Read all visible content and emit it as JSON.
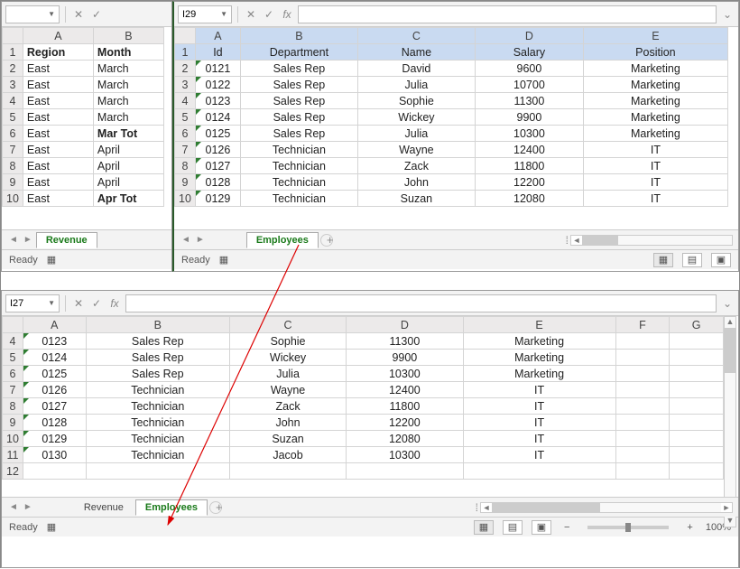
{
  "top_left": {
    "namebox": "",
    "columns": [
      "A",
      "B"
    ],
    "rows": [
      {
        "n": 1,
        "a": "Region",
        "b": "Month",
        "bold": true
      },
      {
        "n": 2,
        "a": "East",
        "b": "March"
      },
      {
        "n": 3,
        "a": "East",
        "b": "March"
      },
      {
        "n": 4,
        "a": "East",
        "b": "March"
      },
      {
        "n": 5,
        "a": "East",
        "b": "March"
      },
      {
        "n": 6,
        "a": "East",
        "b": "Mar Tot",
        "bbold": true
      },
      {
        "n": 7,
        "a": "East",
        "b": "April"
      },
      {
        "n": 8,
        "a": "East",
        "b": "April"
      },
      {
        "n": 9,
        "a": "East",
        "b": "April"
      },
      {
        "n": 10,
        "a": "East",
        "b": "Apr Tot",
        "bbold": true
      }
    ],
    "tabs": {
      "active": "Revenue"
    },
    "status": "Ready"
  },
  "top_right": {
    "namebox": "I29",
    "columns": [
      "A",
      "B",
      "C",
      "D",
      "E"
    ],
    "header_row": {
      "n": 1,
      "cells": [
        "Id",
        "Department",
        "Name",
        "Salary",
        "Position"
      ]
    },
    "rows": [
      {
        "n": 2,
        "cells": [
          "0121",
          "Sales Rep",
          "David",
          "9600",
          "Marketing"
        ]
      },
      {
        "n": 3,
        "cells": [
          "0122",
          "Sales Rep",
          "Julia",
          "10700",
          "Marketing"
        ]
      },
      {
        "n": 4,
        "cells": [
          "0123",
          "Sales Rep",
          "Sophie",
          "11300",
          "Marketing"
        ]
      },
      {
        "n": 5,
        "cells": [
          "0124",
          "Sales Rep",
          "Wickey",
          "9900",
          "Marketing"
        ]
      },
      {
        "n": 6,
        "cells": [
          "0125",
          "Sales Rep",
          "Julia",
          "10300",
          "Marketing"
        ]
      },
      {
        "n": 7,
        "cells": [
          "0126",
          "Technician",
          "Wayne",
          "12400",
          "IT"
        ]
      },
      {
        "n": 8,
        "cells": [
          "0127",
          "Technician",
          "Zack",
          "11800",
          "IT"
        ]
      },
      {
        "n": 9,
        "cells": [
          "0128",
          "Technician",
          "John",
          "12200",
          "IT"
        ]
      },
      {
        "n": 10,
        "cells": [
          "0129",
          "Technician",
          "Suzan",
          "12080",
          "IT"
        ]
      }
    ],
    "tabs": {
      "inactive": "",
      "active": "Employees"
    },
    "status": "Ready"
  },
  "bottom": {
    "namebox": "I27",
    "columns": [
      "A",
      "B",
      "C",
      "D",
      "E",
      "F",
      "G"
    ],
    "rows": [
      {
        "n": 4,
        "cells": [
          "0123",
          "Sales Rep",
          "Sophie",
          "11300",
          "Marketing",
          "",
          ""
        ]
      },
      {
        "n": 5,
        "cells": [
          "0124",
          "Sales Rep",
          "Wickey",
          "9900",
          "Marketing",
          "",
          ""
        ]
      },
      {
        "n": 6,
        "cells": [
          "0125",
          "Sales Rep",
          "Julia",
          "10300",
          "Marketing",
          "",
          ""
        ]
      },
      {
        "n": 7,
        "cells": [
          "0126",
          "Technician",
          "Wayne",
          "12400",
          "IT",
          "",
          ""
        ]
      },
      {
        "n": 8,
        "cells": [
          "0127",
          "Technician",
          "Zack",
          "11800",
          "IT",
          "",
          ""
        ]
      },
      {
        "n": 9,
        "cells": [
          "0128",
          "Technician",
          "John",
          "12200",
          "IT",
          "",
          ""
        ]
      },
      {
        "n": 10,
        "cells": [
          "0129",
          "Technician",
          "Suzan",
          "12080",
          "IT",
          "",
          ""
        ]
      },
      {
        "n": 11,
        "cells": [
          "0130",
          "Technician",
          "Jacob",
          "10300",
          "IT",
          "",
          ""
        ]
      },
      {
        "n": 12,
        "cells": [
          "",
          "",
          "",
          "",
          "",
          "",
          ""
        ]
      }
    ],
    "tabs": {
      "inactive": "Revenue",
      "active": "Employees"
    },
    "status": "Ready",
    "zoom": "100%"
  },
  "chart_data": {
    "type": "table",
    "title": "Employees",
    "columns": [
      "Id",
      "Department",
      "Name",
      "Salary",
      "Position"
    ],
    "rows": [
      [
        "0121",
        "Sales Rep",
        "David",
        9600,
        "Marketing"
      ],
      [
        "0122",
        "Sales Rep",
        "Julia",
        10700,
        "Marketing"
      ],
      [
        "0123",
        "Sales Rep",
        "Sophie",
        11300,
        "Marketing"
      ],
      [
        "0124",
        "Sales Rep",
        "Wickey",
        9900,
        "Marketing"
      ],
      [
        "0125",
        "Sales Rep",
        "Julia",
        10300,
        "Marketing"
      ],
      [
        "0126",
        "Technician",
        "Wayne",
        12400,
        "IT"
      ],
      [
        "0127",
        "Technician",
        "Zack",
        11800,
        "IT"
      ],
      [
        "0128",
        "Technician",
        "John",
        12200,
        "IT"
      ],
      [
        "0129",
        "Technician",
        "Suzan",
        12080,
        "IT"
      ],
      [
        "0130",
        "Technician",
        "Jacob",
        10300,
        "IT"
      ]
    ]
  }
}
